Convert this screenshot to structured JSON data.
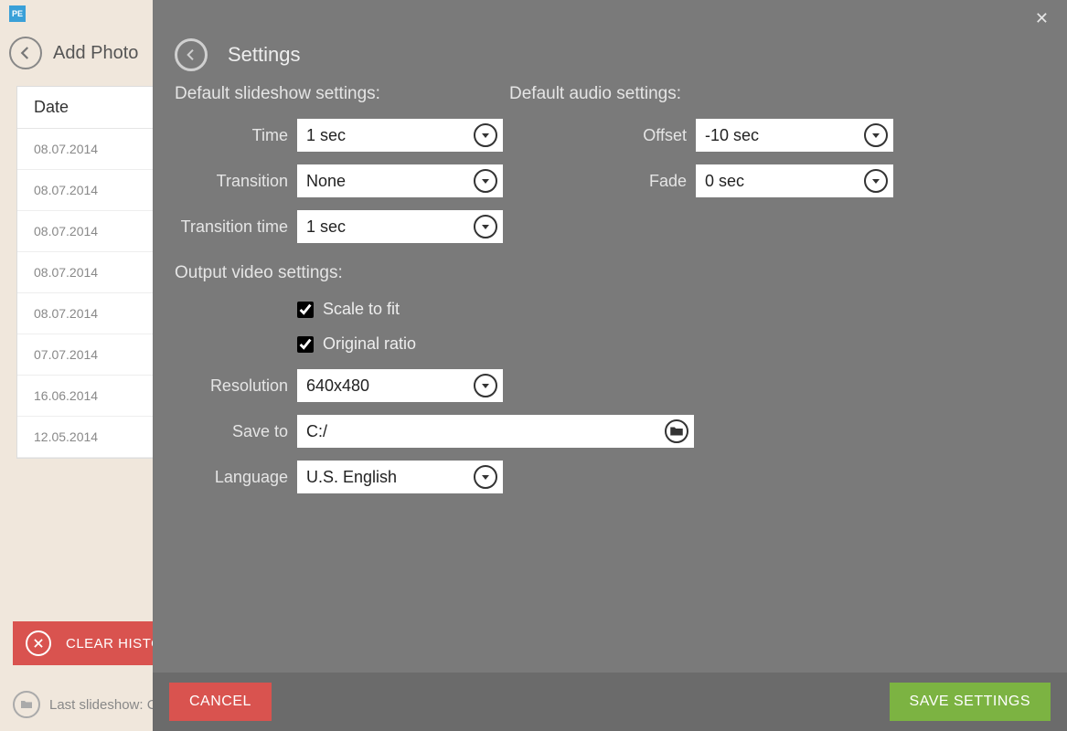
{
  "bg": {
    "add_photo": "Add Photo",
    "date_header": "Date",
    "dates": [
      "08.07.2014",
      "08.07.2014",
      "08.07.2014",
      "08.07.2014",
      "08.07.2014",
      "07.07.2014",
      "16.06.2014",
      "12.05.2014"
    ],
    "clear_history": "CLEAR HISTORY",
    "last_slideshow": "Last slideshow: C"
  },
  "modal": {
    "title": "Settings",
    "sections": {
      "slideshow": "Default slideshow settings:",
      "audio": "Default audio settings:",
      "output": "Output video settings:"
    },
    "labels": {
      "time": "Time",
      "transition": "Transition",
      "transition_time": "Transition time",
      "offset": "Offset",
      "fade": "Fade",
      "scale": "Scale to fit",
      "original_ratio": "Original ratio",
      "resolution": "Resolution",
      "save_to": "Save to",
      "language": "Language"
    },
    "values": {
      "time": "1 sec",
      "transition": "None",
      "transition_time": "1 sec",
      "offset": "-10 sec",
      "fade": "0 sec",
      "scale_checked": true,
      "original_ratio_checked": true,
      "resolution": "640x480",
      "save_to": "C:/",
      "language": "U.S. English"
    },
    "buttons": {
      "cancel": "CANCEL",
      "save": "SAVE SETTINGS"
    }
  }
}
